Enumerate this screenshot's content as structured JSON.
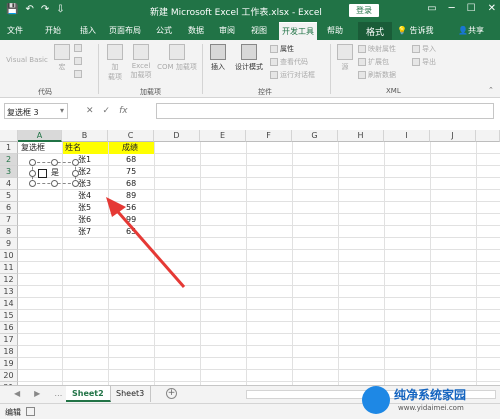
{
  "window": {
    "title": "新建 Microsoft Excel 工作表.xlsx  -  Excel",
    "login_label": "登录",
    "controls": [
      "▭",
      "─",
      "☐",
      "✕"
    ]
  },
  "tabs": [
    "文件",
    "开始",
    "插入",
    "页面布局",
    "公式",
    "数据",
    "审阅",
    "视图",
    "开发工具",
    "帮助"
  ],
  "active_tab": "开发工具",
  "contextual_tab": "格式",
  "tell_me": "告诉我",
  "share": "共享",
  "ribbon": {
    "code": {
      "visual_basic": "Visual Basic",
      "macro": "宏",
      "record_macro": "录制宏",
      "relative_refs": "使用相对引用",
      "macro_security": "宏安全性",
      "label": "代码"
    },
    "addins": {
      "addins": "加\n载项",
      "excel_addins": "Excel\n加载项",
      "com_addins": "COM 加载项",
      "label": "加载项"
    },
    "controls": {
      "insert": "插入",
      "design_mode": "设计模式",
      "properties": "属性",
      "view_code": "查看代码",
      "run_dialog": "运行对话框",
      "label": "控件"
    },
    "xml": {
      "source": "源",
      "map_properties": "映射属性",
      "expansion_packs": "扩展包",
      "refresh_data": "刷新数据",
      "import": "导入",
      "export": "导出",
      "label": "XML"
    }
  },
  "formula_bar": {
    "name_box": "复选框 3",
    "cancel": "✕",
    "enter": "✓",
    "fx": "fx",
    "value": ""
  },
  "columns": [
    "A",
    "B",
    "C",
    "D",
    "E",
    "F",
    "G",
    "H",
    "I",
    "J"
  ],
  "rows": [
    "1",
    "2",
    "3",
    "4",
    "5",
    "6",
    "7",
    "8",
    "9",
    "10",
    "11",
    "12",
    "13",
    "14",
    "15",
    "16",
    "17",
    "18",
    "19",
    "20",
    "21"
  ],
  "cells": {
    "A1": "复选框",
    "B1": "姓名",
    "C1": "成绩",
    "B": [
      "张1",
      "张2",
      "张3",
      "张4",
      "张5",
      "张6",
      "张7"
    ],
    "C": [
      "68",
      "75",
      "68",
      "89",
      "56",
      "99",
      "65"
    ]
  },
  "checkbox_label": "是",
  "sheets": [
    "Sheet2",
    "Sheet3"
  ],
  "active_sheet": "Sheet2",
  "status": "编辑",
  "watermark": {
    "name": "纯净系统家园",
    "url": "www.yidaimei.com"
  },
  "colors": {
    "excel_green": "#217346",
    "header_highlight": "#ffff00",
    "annotation_arrow": "#e53935"
  }
}
